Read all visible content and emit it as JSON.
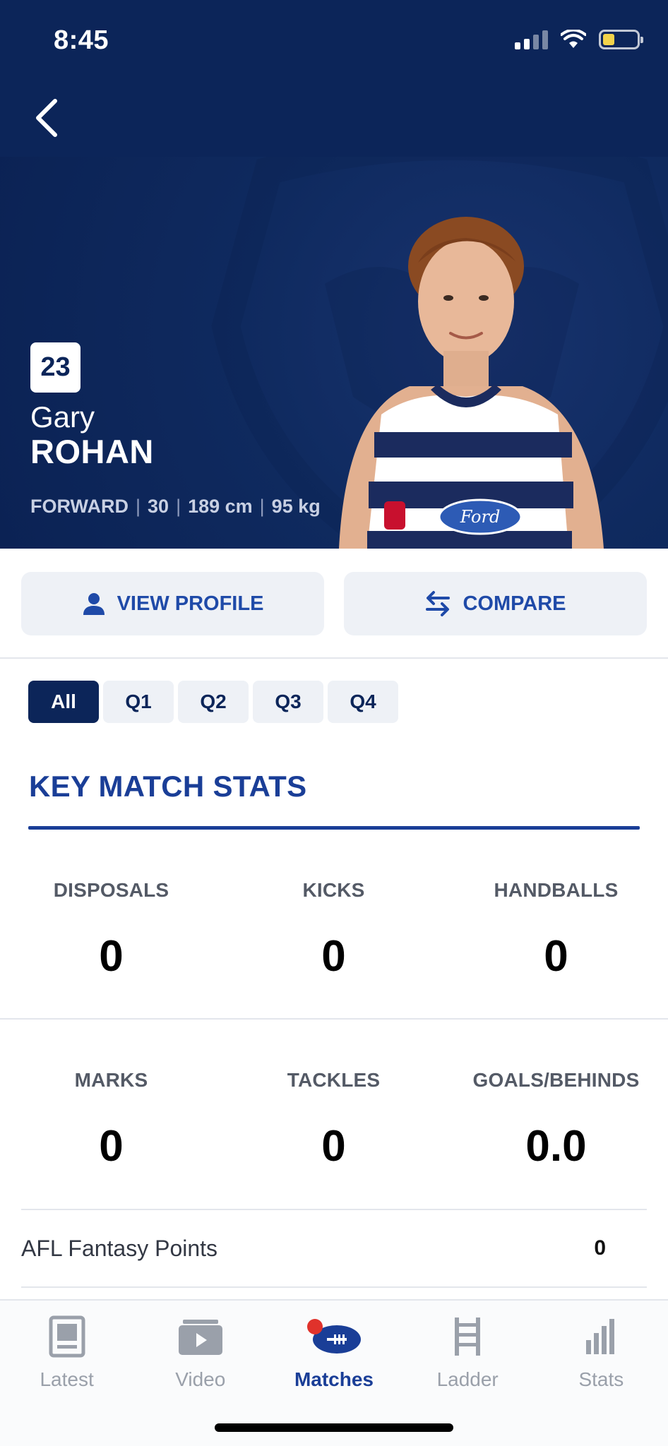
{
  "status_bar": {
    "time": "8:45"
  },
  "player": {
    "number": "23",
    "first_name": "Gary",
    "last_name": "ROHAN",
    "position": "FORWARD",
    "age": "30",
    "height": "189 cm",
    "weight": "95 kg"
  },
  "actions": {
    "view_profile": "VIEW PROFILE",
    "compare": "COMPARE"
  },
  "quarter_tabs": [
    "All",
    "Q1",
    "Q2",
    "Q3",
    "Q4"
  ],
  "section_title": "KEY MATCH STATS",
  "stats": [
    {
      "label": "DISPOSALS",
      "value": "0"
    },
    {
      "label": "KICKS",
      "value": "0"
    },
    {
      "label": "HANDBALLS",
      "value": "0"
    },
    {
      "label": "MARKS",
      "value": "0"
    },
    {
      "label": "TACKLES",
      "value": "0"
    },
    {
      "label": "GOALS/BEHINDS",
      "value": "0.0"
    }
  ],
  "fantasy": {
    "label": "AFL Fantasy Points",
    "value": "0"
  },
  "tab_bar": [
    {
      "label": "Latest",
      "icon": "latest-icon"
    },
    {
      "label": "Video",
      "icon": "video-icon"
    },
    {
      "label": "Matches",
      "icon": "matches-icon",
      "active": true
    },
    {
      "label": "Ladder",
      "icon": "ladder-icon"
    },
    {
      "label": "Stats",
      "icon": "stats-icon"
    }
  ],
  "colors": {
    "navy": "#0c2559",
    "accent": "#1a3e97",
    "notification": "#e0322b"
  }
}
